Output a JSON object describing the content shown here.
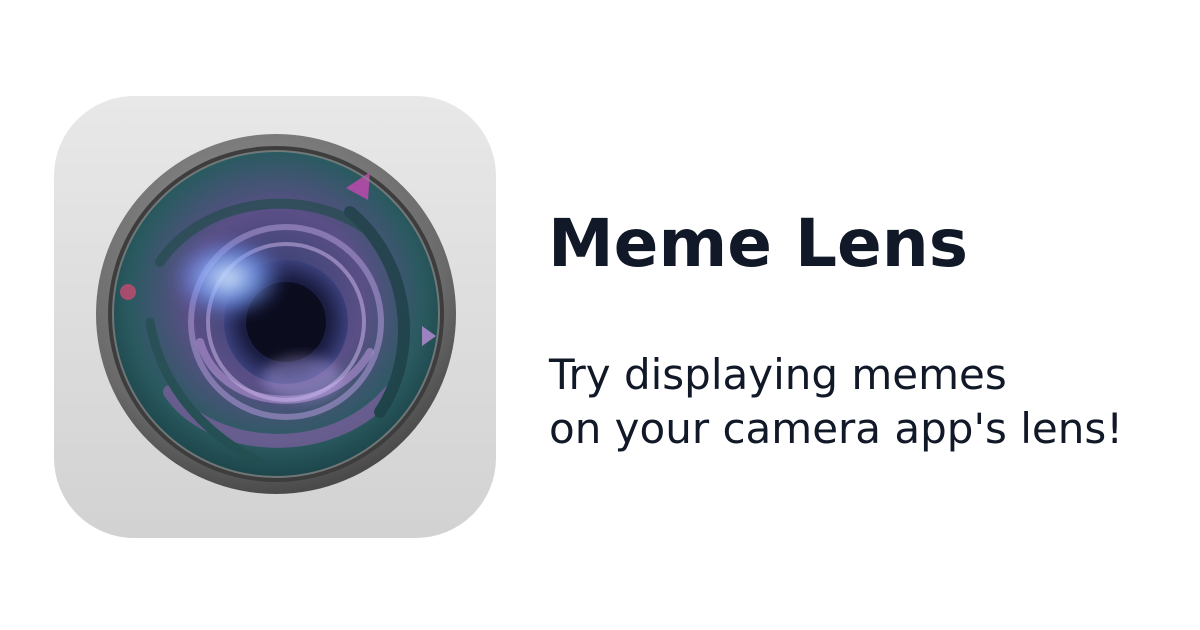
{
  "app": {
    "name": "Meme Lens",
    "tagline_lines": [
      "Try displaying memes",
      "on your camera app's lens!"
    ],
    "icon": "camera-lens-icon"
  },
  "colors": {
    "text": "#111827",
    "icon_body": "#dcdcdc",
    "lens_ring": "#6e6e6e",
    "lens_glass": "#1f5a5e",
    "lens_tint": "#8a6fb0"
  }
}
